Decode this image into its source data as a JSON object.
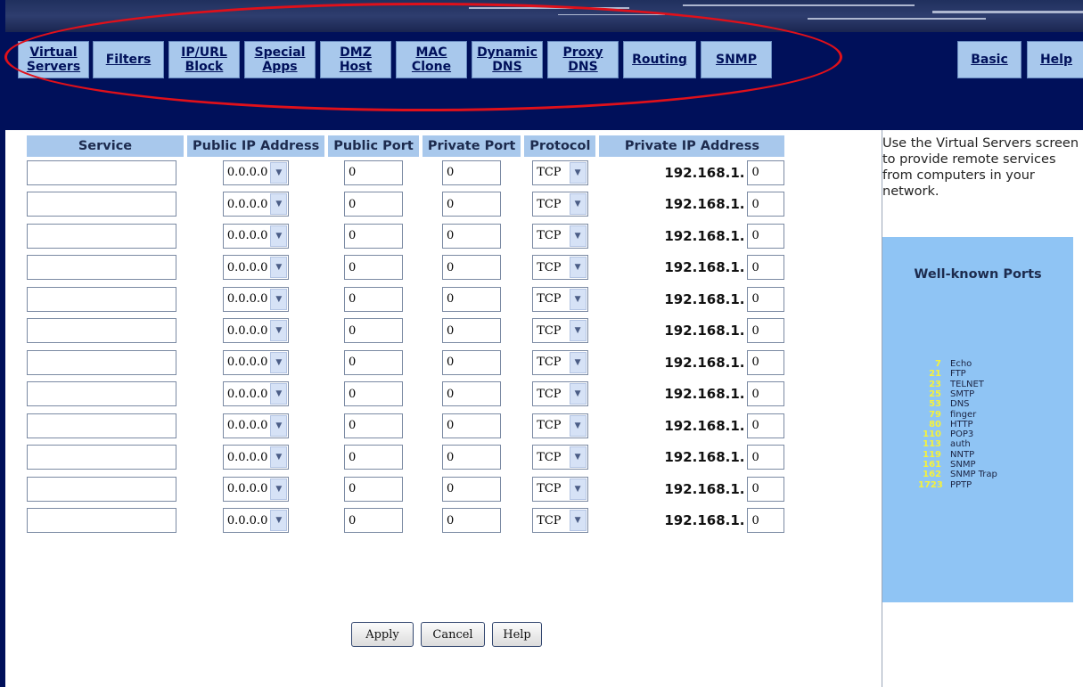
{
  "nav": {
    "tabs": [
      {
        "key": "virtual-servers",
        "label": "Virtual\nServers"
      },
      {
        "key": "filters",
        "label": "Filters"
      },
      {
        "key": "ip-url-block",
        "label": "IP/URL\nBlock"
      },
      {
        "key": "special-apps",
        "label": "Special\nApps"
      },
      {
        "key": "dmz-host",
        "label": "DMZ\nHost"
      },
      {
        "key": "mac-clone",
        "label": "MAC\nClone"
      },
      {
        "key": "dynamic-dns",
        "label": "Dynamic\nDNS"
      },
      {
        "key": "proxy-dns",
        "label": "Proxy\nDNS"
      },
      {
        "key": "routing",
        "label": "Routing"
      },
      {
        "key": "snmp",
        "label": "SNMP"
      }
    ],
    "basic_label": "Basic",
    "help_label": "Help"
  },
  "table": {
    "headers": {
      "service": "Service",
      "public_ip": "Public IP Address",
      "public_port": "Public Port",
      "private_port": "Private Port",
      "protocol": "Protocol",
      "private_ip": "Private IP Address"
    },
    "rows": [
      {
        "service": "",
        "public_ip": "0.0.0.0",
        "public_port": "0",
        "private_port": "0",
        "protocol": "TCP",
        "ip_prefix": "192.168.1.",
        "last_octet": "0"
      },
      {
        "service": "",
        "public_ip": "0.0.0.0",
        "public_port": "0",
        "private_port": "0",
        "protocol": "TCP",
        "ip_prefix": "192.168.1.",
        "last_octet": "0"
      },
      {
        "service": "",
        "public_ip": "0.0.0.0",
        "public_port": "0",
        "private_port": "0",
        "protocol": "TCP",
        "ip_prefix": "192.168.1.",
        "last_octet": "0"
      },
      {
        "service": "",
        "public_ip": "0.0.0.0",
        "public_port": "0",
        "private_port": "0",
        "protocol": "TCP",
        "ip_prefix": "192.168.1.",
        "last_octet": "0"
      },
      {
        "service": "",
        "public_ip": "0.0.0.0",
        "public_port": "0",
        "private_port": "0",
        "protocol": "TCP",
        "ip_prefix": "192.168.1.",
        "last_octet": "0"
      },
      {
        "service": "",
        "public_ip": "0.0.0.0",
        "public_port": "0",
        "private_port": "0",
        "protocol": "TCP",
        "ip_prefix": "192.168.1.",
        "last_octet": "0"
      },
      {
        "service": "",
        "public_ip": "0.0.0.0",
        "public_port": "0",
        "private_port": "0",
        "protocol": "TCP",
        "ip_prefix": "192.168.1.",
        "last_octet": "0"
      },
      {
        "service": "",
        "public_ip": "0.0.0.0",
        "public_port": "0",
        "private_port": "0",
        "protocol": "TCP",
        "ip_prefix": "192.168.1.",
        "last_octet": "0"
      },
      {
        "service": "",
        "public_ip": "0.0.0.0",
        "public_port": "0",
        "private_port": "0",
        "protocol": "TCP",
        "ip_prefix": "192.168.1.",
        "last_octet": "0"
      },
      {
        "service": "",
        "public_ip": "0.0.0.0",
        "public_port": "0",
        "private_port": "0",
        "protocol": "TCP",
        "ip_prefix": "192.168.1.",
        "last_octet": "0"
      },
      {
        "service": "",
        "public_ip": "0.0.0.0",
        "public_port": "0",
        "private_port": "0",
        "protocol": "TCP",
        "ip_prefix": "192.168.1.",
        "last_octet": "0"
      },
      {
        "service": "",
        "public_ip": "0.0.0.0",
        "public_port": "0",
        "private_port": "0",
        "protocol": "TCP",
        "ip_prefix": "192.168.1.",
        "last_octet": "0"
      }
    ]
  },
  "buttons": {
    "apply": "Apply",
    "cancel": "Cancel",
    "help": "Help"
  },
  "side": {
    "help_text": "Use the Virtual Servers screen to provide remote services from computers in your network.",
    "ports_title": "Well-known Ports",
    "ports": [
      {
        "num": "7",
        "name": "Echo"
      },
      {
        "num": "21",
        "name": "FTP"
      },
      {
        "num": "23",
        "name": "TELNET"
      },
      {
        "num": "25",
        "name": "SMTP"
      },
      {
        "num": "53",
        "name": "DNS"
      },
      {
        "num": "79",
        "name": "finger"
      },
      {
        "num": "80",
        "name": "HTTP"
      },
      {
        "num": "110",
        "name": "POP3"
      },
      {
        "num": "113",
        "name": "auth"
      },
      {
        "num": "119",
        "name": "NNTP"
      },
      {
        "num": "161",
        "name": "SNMP"
      },
      {
        "num": "162",
        "name": "SNMP Trap"
      },
      {
        "num": "1723",
        "name": "PPTP"
      }
    ]
  },
  "colors": {
    "nav_background": "#00105a",
    "tab_fill": "#a8c8ec",
    "annotation": "#e0101a",
    "ports_panel": "#8fc4f4",
    "port_number": "#f6f23a"
  }
}
